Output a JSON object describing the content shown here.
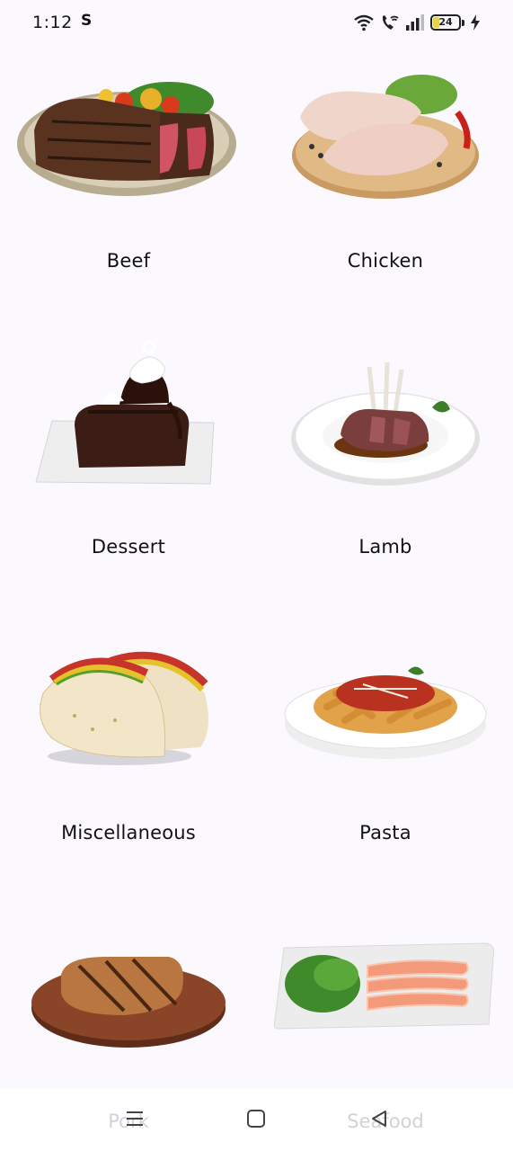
{
  "status_bar": {
    "time": "1:12",
    "carrier_icon": "S",
    "battery": "24",
    "icons": [
      "wifi-icon",
      "wifi-call-icon",
      "signal-icon",
      "battery-icon",
      "charging-icon"
    ]
  },
  "categories": [
    {
      "name": "Beef",
      "icon": "steak-image"
    },
    {
      "name": "Chicken",
      "icon": "chicken-image"
    },
    {
      "name": "Dessert",
      "icon": "brownie-image"
    },
    {
      "name": "Lamb",
      "icon": "lamb-chops-image"
    },
    {
      "name": "Miscellaneous",
      "icon": "tacos-image"
    },
    {
      "name": "Pasta",
      "icon": "pasta-image"
    },
    {
      "name": "Pork",
      "icon": "pork-chop-image"
    },
    {
      "name": "Seafood",
      "icon": "salmon-image"
    }
  ],
  "nav": {
    "buttons": [
      "menu-icon",
      "home-icon",
      "back-icon"
    ]
  },
  "colors": {
    "background": "#fbf9fe",
    "battery_fill": "#e9d24b"
  }
}
